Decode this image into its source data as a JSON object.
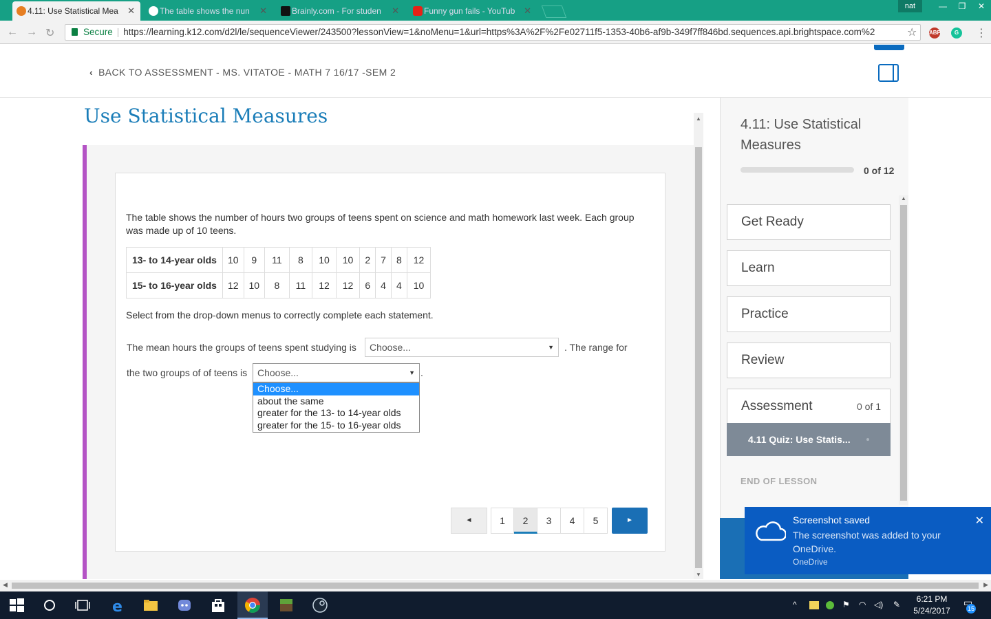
{
  "browser": {
    "tabs": [
      {
        "title": "4.11: Use Statistical Mea"
      },
      {
        "title": "The table shows the nun"
      },
      {
        "title": "Brainly.com - For studen"
      },
      {
        "title": "Funny gun fails - YouTub"
      }
    ],
    "user": "nat",
    "secure_label": "Secure",
    "url": "https://learning.k12.com/d2l/le/sequenceViewer/243500?lessonView=1&noMenu=1&url=https%3A%2F%2Fe02711f5-1353-40b6-af9b-349f7ff846bd.sequences.api.brightspace.com%2",
    "ext_abp": "ABP",
    "ext_g": "G"
  },
  "header": {
    "back_label": "BACK TO ASSESSMENT - MS. VITATOE - MATH 7 16/17 -SEM 2"
  },
  "main": {
    "lesson_title": "Use Statistical Measures",
    "question": "The table shows the number of hours two groups of teens spent on science and math homework last week. Each group was made up of 10 teens.",
    "table": {
      "rows": [
        {
          "label": "13- to 14-year olds",
          "values": [
            "10",
            "9",
            "11",
            "8",
            "10",
            "10",
            "2",
            "7",
            "8",
            "12"
          ]
        },
        {
          "label": "15- to 16-year olds",
          "values": [
            "12",
            "10",
            "8",
            "11",
            "12",
            "12",
            "6",
            "4",
            "4",
            "10"
          ]
        }
      ]
    },
    "instruction": "Select from the drop-down menus to correctly complete each statement.",
    "statement1_pre": "The mean hours the groups of teens spent studying is",
    "statement1_post": ". The range for",
    "statement2_pre": "the two groups of of teens is",
    "select1_value": "Choose...",
    "select2_value": "Choose...",
    "dropdown_options": [
      "Choose...",
      "about the same",
      "greater for the 13- to 14-year olds",
      "greater for the 15- to 16-year olds"
    ],
    "pager": {
      "prev": "◄",
      "pages": [
        "1",
        "2",
        "3",
        "4",
        "5"
      ],
      "current_index": 1,
      "next": "►"
    }
  },
  "sidebar": {
    "title": "4.11: Use Statistical Measures",
    "progress_label": "0 of 12",
    "progress_value": 0,
    "items": [
      {
        "label": "Get Ready"
      },
      {
        "label": "Learn"
      },
      {
        "label": "Practice"
      },
      {
        "label": "Review"
      },
      {
        "label": "Assessment",
        "count": "0 of 1"
      }
    ],
    "sub_item": "4.11 Quiz: Use Statis...",
    "end_label": "END OF LESSON"
  },
  "toast": {
    "title": "Screenshot saved",
    "body": "The screenshot was added to your OneDrive.",
    "source": "OneDrive"
  },
  "taskbar": {
    "time": "6:21 PM",
    "date": "5/24/2017",
    "notifications": "15"
  },
  "colors": {
    "accent": "#1a7db8",
    "tabbar": "#16a085",
    "band": "#b453c5",
    "toast": "#0a5cc2"
  }
}
